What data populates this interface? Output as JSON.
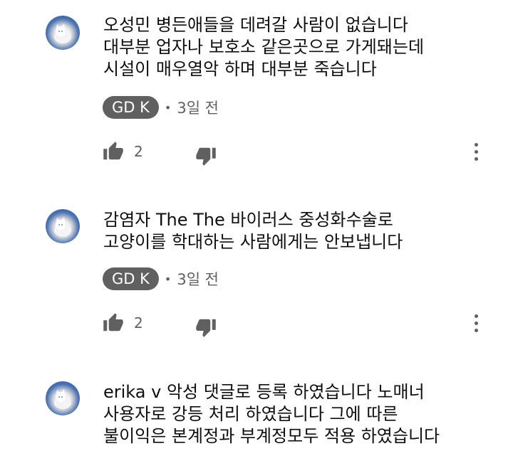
{
  "comments": [
    {
      "lines": [
        "오성민 병든애들을 데려갈 사람이 없습니다",
        "대부분 업자나 보호소 같은곳으로 가게돼는데",
        "시설이 매우열악 하며 대부분 죽습니다"
      ],
      "author": "GD K",
      "time": "3일 전",
      "likes": "2"
    },
    {
      "lines": [
        "감염자 The The 바이러스 중성화수술로",
        "고양이를 학대하는 사람에게는 안보냅니다"
      ],
      "author": "GD K",
      "time": "3일 전",
      "likes": "2"
    },
    {
      "lines": [
        "erika v 악성 댓글로 등록 하였습니다 노매너",
        "사용자로 강등 처리 하였습니다 그에 따른",
        "불이익은 본계정과 부계정모두 적용 하였습니다"
      ]
    }
  ],
  "separator": "•",
  "icons": {
    "avatar": "white-cat-avatar",
    "like": "thumbs-up-icon",
    "dislike": "thumbs-down-icon",
    "more": "more-vertical-icon"
  },
  "colors": {
    "text": "#0f0f0f",
    "secondary": "#606060",
    "chip_bg": "#606060",
    "chip_text": "#ffffff"
  }
}
